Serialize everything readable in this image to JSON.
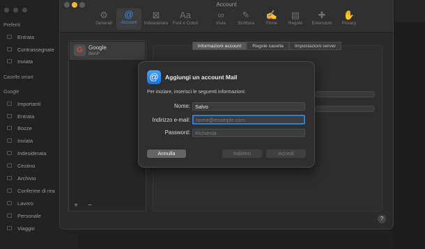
{
  "mail": {
    "sidebar_headers": [
      "Preferiti",
      "Caselle smart",
      "Google"
    ],
    "favorites": [
      "Entrata",
      "Contrassegnate",
      "Inviata"
    ],
    "google_items": [
      "Importanti",
      "Entrata",
      "Bozze",
      "Inviata",
      "Indesiderata",
      "Cestino",
      "Archivio",
      "Conferme di rea",
      "Lavoro",
      "Personale",
      "Viaggio"
    ]
  },
  "window": {
    "title": "Account",
    "toolbar": [
      {
        "label": "Generali",
        "icon": "gear-icon"
      },
      {
        "label": "Account",
        "icon": "at-sign-icon",
        "active": true
      },
      {
        "label": "Indesiderata",
        "icon": "junk-tray-icon"
      },
      {
        "label": "Font e Colori",
        "icon": "font-icon"
      },
      {
        "label": "Vista",
        "icon": "glasses-icon"
      },
      {
        "label": "Scrittura",
        "icon": "compose-icon"
      },
      {
        "label": "Firme",
        "icon": "signature-icon"
      },
      {
        "label": "Regole",
        "icon": "rules-icon"
      },
      {
        "label": "Estensioni",
        "icon": "puzzle-icon"
      },
      {
        "label": "Privacy",
        "icon": "hand-icon"
      }
    ],
    "account": {
      "name": "Google",
      "type": "IMAP"
    },
    "list_buttons": {
      "add": "+",
      "remove": "−"
    },
    "tabs": [
      "Informazioni account",
      "Regole casella",
      "Impostazioni server"
    ],
    "help": "?"
  },
  "modal": {
    "title": "Aggiungi un account Mail",
    "subtitle": "Per iniziare, inserisci le seguenti informazioni:",
    "fields": {
      "name": {
        "label": "Nome:",
        "value": "Salvo",
        "placeholder": ""
      },
      "email": {
        "label": "Indirizzo e-mail:",
        "value": "",
        "placeholder": "nome@example.com"
      },
      "password": {
        "label": "Password:",
        "value": "",
        "placeholder": "Richiesta"
      }
    },
    "buttons": {
      "cancel": "Annulla",
      "back": "Indietro",
      "sign_in": "Accedi"
    }
  },
  "colors": {
    "accent": "#3a8ee6",
    "focus_ring": "#2f7fd8",
    "gmail_g": "#e34133"
  }
}
